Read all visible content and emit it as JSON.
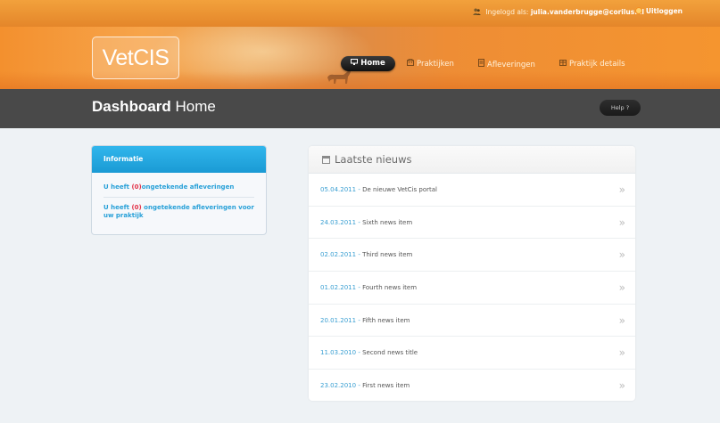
{
  "topbar": {
    "logged_in_label": "Ingelogd als:",
    "user_email": "julia.vanderbrugge@corilus.nl",
    "logout_label": "Uitloggen"
  },
  "header": {
    "logo_text": "VetCIS",
    "nav": {
      "home": "Home",
      "praktijken": "Praktijken",
      "afleveringen": "Afleveringen",
      "praktijk_details": "Praktijk details"
    }
  },
  "titlebar": {
    "title_bold": "Dashboard",
    "title_rest": "Home",
    "help_label": "Help ?"
  },
  "info": {
    "heading": "Informatie",
    "line1_prefix": "U heeft ",
    "line1_count": "(0)",
    "line1_suffix": "ongetekende afleveringen",
    "line2_prefix": "U heeft ",
    "line2_count": "(0)",
    "line2_suffix": " ongetekende afleveringen voor uw praktijk"
  },
  "news": {
    "heading": "Laatste nieuws",
    "items": [
      {
        "date": "05.04.2011",
        "title": "De nieuwe VetCis portal"
      },
      {
        "date": "24.03.2011",
        "title": "Sixth news item"
      },
      {
        "date": "02.02.2011",
        "title": "Third news item"
      },
      {
        "date": "01.02.2011",
        "title": "Fourth news item"
      },
      {
        "date": "20.01.2011",
        "title": "Fifth news item"
      },
      {
        "date": "11.03.2010",
        "title": "Second news title"
      },
      {
        "date": "23.02.2010",
        "title": "First news item"
      }
    ],
    "separator": " - ",
    "arrow": "»"
  },
  "colors": {
    "accent_orange": "#f08f2c",
    "link_blue": "#27a0d8",
    "count_red": "#e2344a",
    "titlebar_gray": "#494949"
  },
  "icons": {
    "user": "user-icon",
    "logout": "logout-icon",
    "home": "monitor-icon",
    "praktijken": "building-icon",
    "afleveringen": "document-icon",
    "praktijk_details": "building-details-icon",
    "news": "calendar-icon",
    "row_arrow": "double-chevron-right-icon"
  }
}
